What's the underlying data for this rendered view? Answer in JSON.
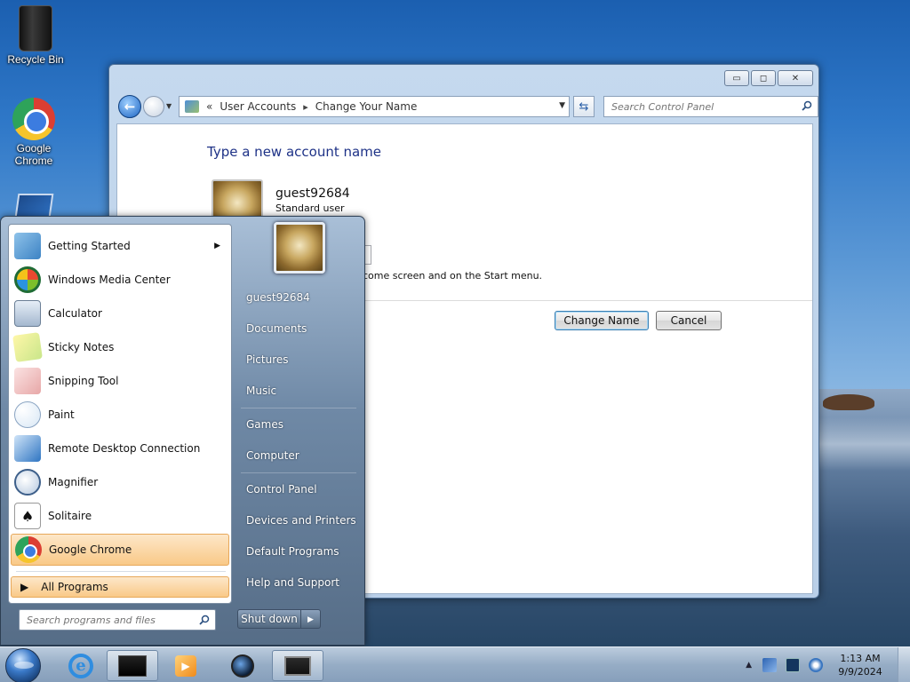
{
  "desktop": {
    "icons": [
      {
        "label": "Recycle Bin",
        "icon": "recycle-bin-icon"
      },
      {
        "label": "Google Chrome",
        "icon": "chrome-icon"
      },
      {
        "label": "",
        "icon": "virtualbox-icon"
      }
    ]
  },
  "window": {
    "address": {
      "root_glyph": "«",
      "crumbs": [
        "User Accounts",
        "Change Your Name"
      ]
    },
    "search_placeholder": "Search Control Panel",
    "controls": {
      "minimize": "▭",
      "maximize": "◻",
      "close": "✕"
    },
    "content": {
      "heading": "Type a new account name",
      "account_name": "guest92684",
      "account_type": "Standard user",
      "hint_text": "come screen and on the Start menu.",
      "change_button": "Change Name",
      "cancel_button": "Cancel"
    }
  },
  "start_menu": {
    "pinned": [
      {
        "label": "Getting Started",
        "icon": "getting-started-icon",
        "has_submenu": true
      },
      {
        "label": "Windows Media Center",
        "icon": "media-center-icon"
      },
      {
        "label": "Calculator",
        "icon": "calculator-icon"
      },
      {
        "label": "Sticky Notes",
        "icon": "sticky-notes-icon"
      },
      {
        "label": "Snipping Tool",
        "icon": "snipping-tool-icon"
      },
      {
        "label": "Paint",
        "icon": "paint-icon"
      },
      {
        "label": "Remote Desktop Connection",
        "icon": "remote-desktop-icon"
      },
      {
        "label": "Magnifier",
        "icon": "magnifier-icon"
      },
      {
        "label": "Solitaire",
        "icon": "solitaire-icon"
      },
      {
        "label": "Google Chrome",
        "icon": "chrome-icon",
        "highlighted": true
      }
    ],
    "all_programs": "All Programs",
    "search_placeholder": "Search programs and files",
    "right_items": [
      "guest92684",
      "Documents",
      "Pictures",
      "Music",
      "Games",
      "Computer",
      "Control Panel",
      "Devices and Printers",
      "Default Programs",
      "Help and Support"
    ],
    "shutdown_label": "Shut down"
  },
  "taskbar": {
    "items": [
      "internet-explorer-icon",
      "file-explorer-icon",
      "media-player-icon",
      "webcam-icon",
      "control-panel-icon"
    ],
    "clock": {
      "time": "1:13 AM",
      "date": "9/9/2024"
    }
  },
  "colors": {
    "accent_blue": "#1e3287",
    "highlight_orange": "#f9c987"
  }
}
